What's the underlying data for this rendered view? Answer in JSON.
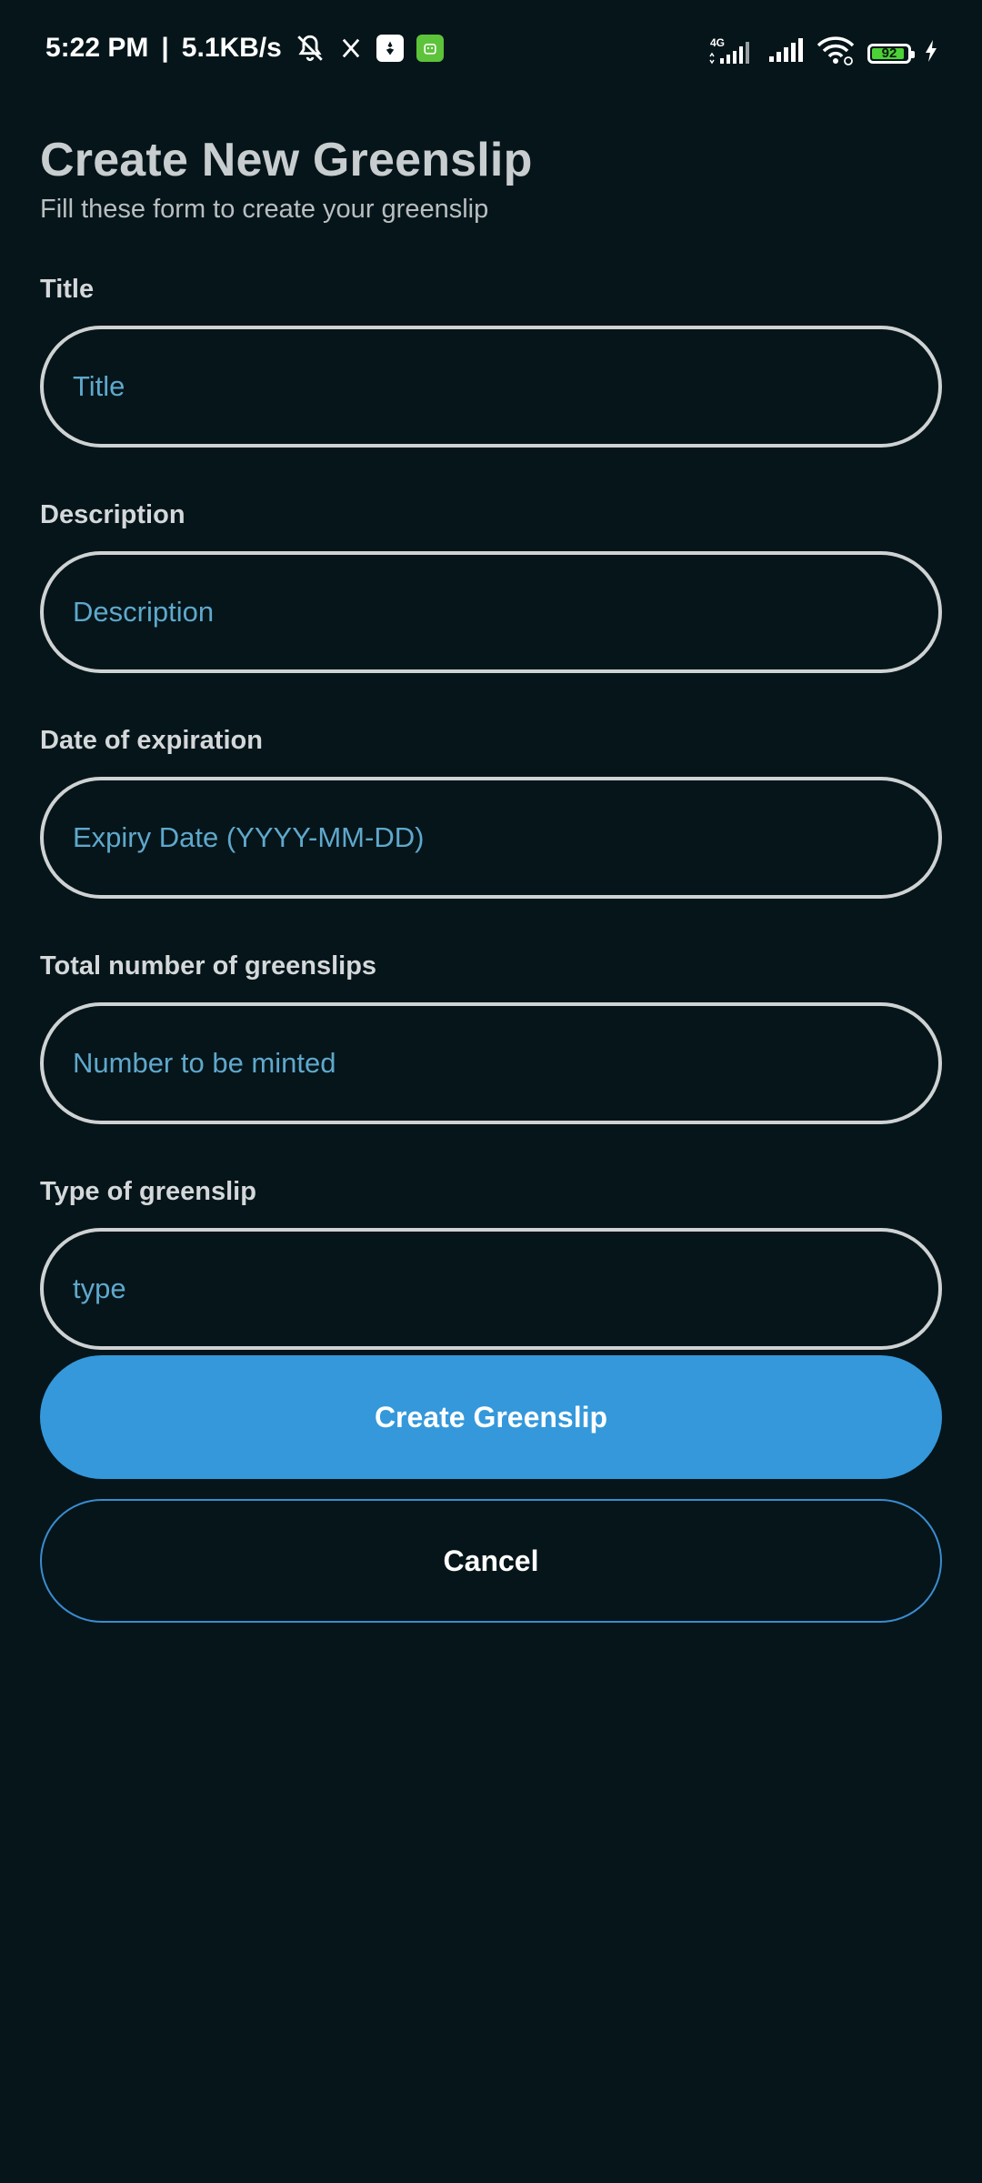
{
  "status_bar": {
    "time": "5:22 PM",
    "separator": "|",
    "speed": "5.1KB/s",
    "network_label": "4G",
    "battery_level": 92,
    "battery_text": "92",
    "icons": [
      "muted-bell-icon",
      "x-app-icon",
      "app-icon-white",
      "android-app-icon",
      "signal-4g-icon",
      "signal-icon",
      "wifi-icon",
      "battery-icon",
      "charging-icon"
    ],
    "colors": {
      "battery_fill": "#4cd137",
      "android_app": "#5cc33b"
    }
  },
  "header": {
    "title": "Create New Greenslip",
    "subtitle": "Fill these form to create your greenslip"
  },
  "form": {
    "fields": [
      {
        "label": "Title",
        "placeholder": "Title",
        "value": ""
      },
      {
        "label": "Description",
        "placeholder": "Description",
        "value": ""
      },
      {
        "label": "Date of expiration",
        "placeholder": "Expiry Date (YYYY-MM-DD)",
        "value": ""
      },
      {
        "label": "Total number of greenslips",
        "placeholder": "Number to be minted",
        "value": ""
      },
      {
        "label": "Type of greenslip",
        "placeholder": "type",
        "value": ""
      }
    ]
  },
  "actions": {
    "create_label": "Create Greenslip",
    "cancel_label": "Cancel"
  },
  "colors": {
    "background": "#05151a",
    "accent": "#3498db",
    "placeholder": "#5fa8cc",
    "input_border": "#cfd2d3"
  }
}
